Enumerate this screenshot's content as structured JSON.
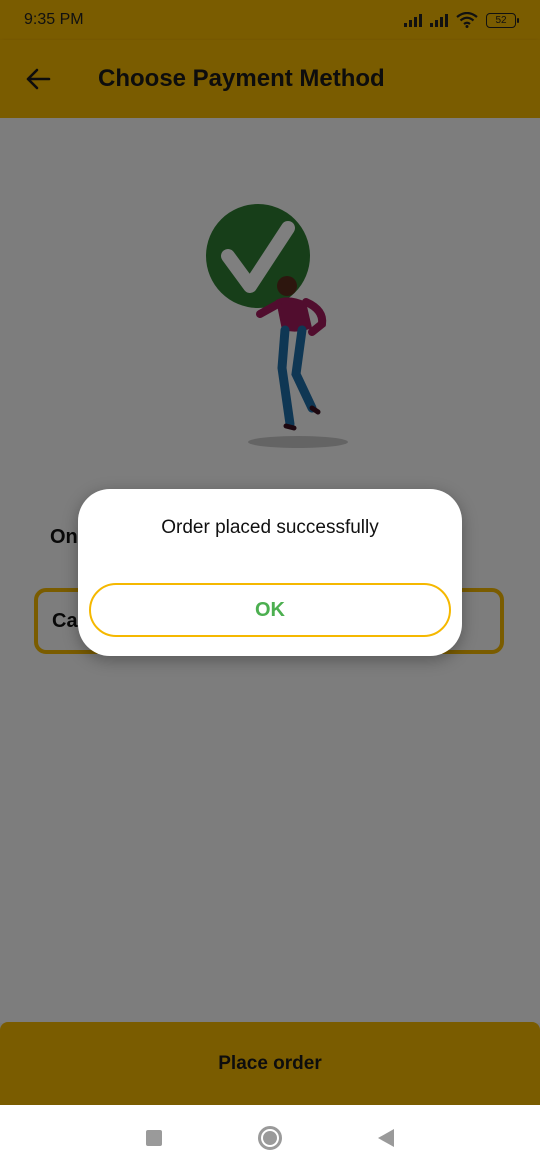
{
  "status_bar": {
    "time": "9:35 PM",
    "battery": "52"
  },
  "app_bar": {
    "title": "Choose Payment Method"
  },
  "content": {
    "online_label": "Online Payment",
    "cash_option_label": "Cash on Delivery"
  },
  "bottom": {
    "place_order_label": "Place order"
  },
  "dialog": {
    "message": "Order placed successfully",
    "ok_label": "OK"
  },
  "colors": {
    "accent": "#f5b800",
    "success": "#2e7d32",
    "ok_text": "#4caf50"
  },
  "icons": {
    "back": "arrow-left-icon",
    "signal": "signal-icon",
    "wifi": "wifi-icon",
    "battery": "battery-icon",
    "nav_recent": "square-icon",
    "nav_home": "circle-icon",
    "nav_back": "triangle-back-icon"
  }
}
